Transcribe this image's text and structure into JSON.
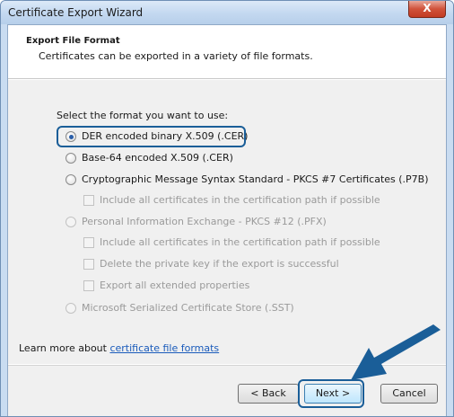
{
  "window": {
    "title": "Certificate Export Wizard",
    "close_label": "X"
  },
  "header": {
    "title": "Export File Format",
    "description": "Certificates can be exported in a variety of file formats."
  },
  "body": {
    "prompt": "Select the format you want to use:",
    "options": [
      {
        "label": "DER encoded binary X.509 (.CER)",
        "selected": true,
        "enabled": true
      },
      {
        "label": "Base-64 encoded X.509 (.CER)",
        "selected": false,
        "enabled": true
      },
      {
        "label": "Cryptographic Message Syntax Standard - PKCS #7 Certificates (.P7B)",
        "selected": false,
        "enabled": true
      },
      {
        "label": "Include all certificates in the certification path if possible",
        "enabled": false
      },
      {
        "label": "Personal Information Exchange - PKCS #12 (.PFX)",
        "selected": false,
        "enabled": false
      },
      {
        "label": "Include all certificates in the certification path if possible",
        "enabled": false
      },
      {
        "label": "Delete the private key if the export is successful",
        "enabled": false
      },
      {
        "label": "Export all extended properties",
        "enabled": false
      },
      {
        "label": "Microsoft Serialized Certificate Store (.SST)",
        "selected": false,
        "enabled": false
      }
    ],
    "learn_more_prefix": "Learn more about ",
    "learn_more_link": "certificate file formats"
  },
  "footer": {
    "back_label": "< Back",
    "next_label": "Next >",
    "cancel_label": "Cancel"
  },
  "colors": {
    "highlight": "#1a5e98",
    "link": "#1a5bbb"
  }
}
